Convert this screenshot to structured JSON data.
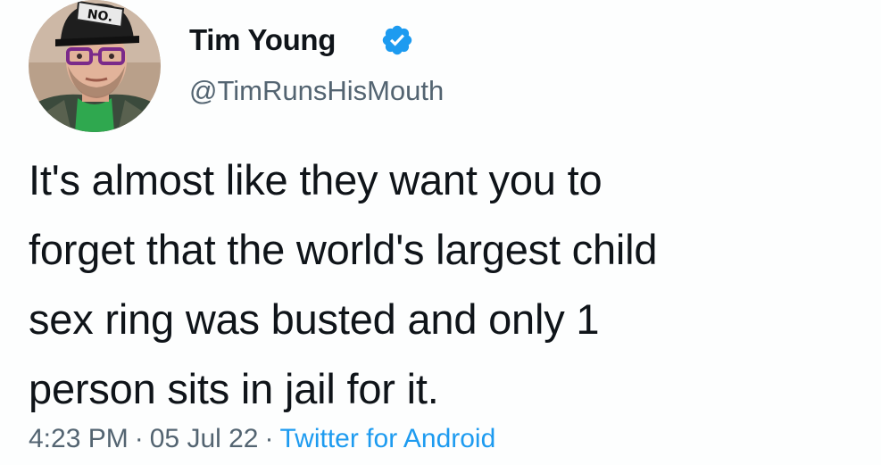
{
  "tweet": {
    "author": {
      "display_name": "Tim Young",
      "handle": "@TimRunsHisMouth",
      "verified": true,
      "avatar_hat_text": "NO."
    },
    "text_lines": [
      "It's almost like they want you to",
      "forget that the world's largest child",
      "sex ring was busted and only 1",
      "person sits in jail for it."
    ],
    "time": "4:23 PM",
    "date": "05 Jul 22",
    "separator": "·",
    "source": "Twitter for Android"
  },
  "colors": {
    "text": "#0f1419",
    "secondary": "#536471",
    "link": "#1d9bf0",
    "verified": "#1d9bf0"
  }
}
